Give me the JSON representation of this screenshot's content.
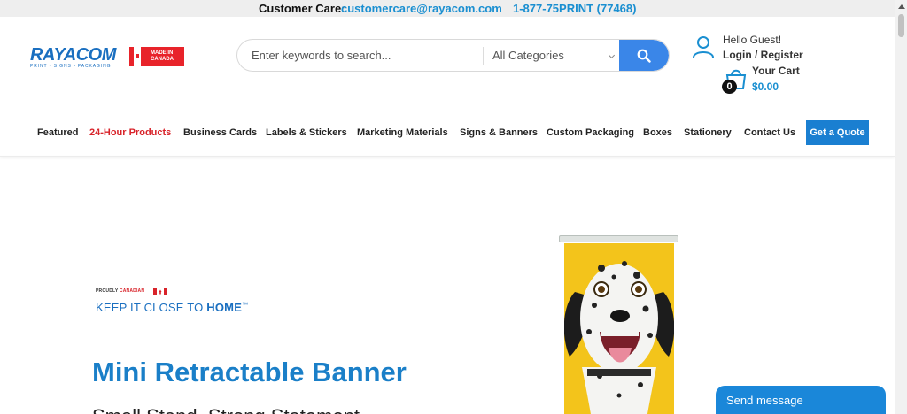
{
  "care_bar": {
    "label": "Customer Care:",
    "email": "customercare@rayacom.com",
    "phone": "1-877-75PRINT (77468)"
  },
  "logo": {
    "wordmark": "RAYACOM",
    "tagline": "PRINT • SIGNS • PACKAGING",
    "badge_line1": "MADE IN",
    "badge_line2": "CANADA"
  },
  "search": {
    "placeholder": "Enter keywords to search...",
    "category_selected": "All Categories"
  },
  "account": {
    "greeting": "Hello Guest!",
    "login_label": "Login / Register"
  },
  "cart": {
    "label": "Your Cart",
    "count": "0",
    "total": "$0.00"
  },
  "nav": {
    "items": [
      {
        "label": "Featured"
      },
      {
        "label": "24-Hour Products"
      },
      {
        "label": "Business Cards"
      },
      {
        "label": "Labels & Stickers"
      },
      {
        "label": "Marketing Materials"
      },
      {
        "label": "Signs & Banners"
      },
      {
        "label": "Custom Packaging"
      },
      {
        "label": "Boxes"
      },
      {
        "label": "Stationery"
      },
      {
        "label": "Contact Us"
      }
    ],
    "quote_label": "Get a Quote"
  },
  "hero": {
    "proudly": "PROUDLY",
    "canadian": "CANADIAN",
    "keep_prefix": "KEEP IT CLOSE TO ",
    "keep_bold": "HOME",
    "keep_tm": "™",
    "title": "Mini Retractable Banner",
    "subtitle": "Small Stand. Strong Statement."
  },
  "chat": {
    "label": "Send message"
  },
  "colors": {
    "brand_blue": "#1a7fc8",
    "link_blue": "#1a8fd1",
    "search_button": "#3a86e8",
    "accent_red": "#d8232a",
    "banner_yellow": "#f3c41b"
  }
}
